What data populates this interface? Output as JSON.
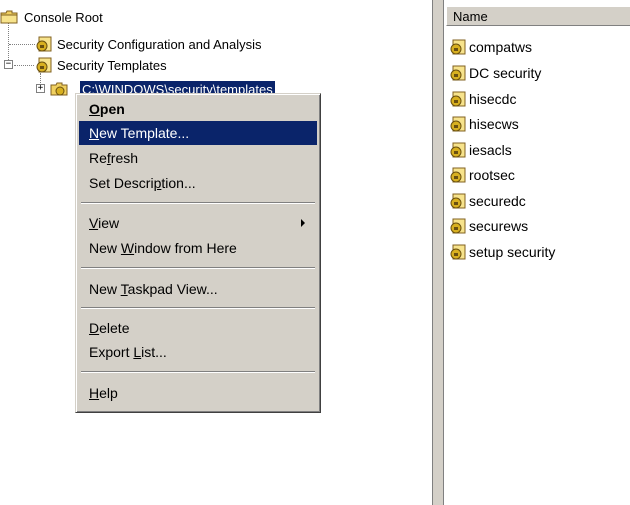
{
  "tree": {
    "root_label": "Console Root",
    "nodes": [
      {
        "label": "Security Configuration and Analysis"
      },
      {
        "label": "Security Templates"
      }
    ],
    "selected_path": "C:\\WINDOWS\\security\\templates"
  },
  "context_menu": {
    "items": [
      {
        "pre": "",
        "key": "O",
        "post": "pen"
      },
      {
        "pre": "",
        "key": "N",
        "post": "ew Template..."
      },
      {
        "pre": "Re",
        "key": "f",
        "post": "resh"
      },
      {
        "pre": "Set Descri",
        "key": "p",
        "post": "tion..."
      },
      {
        "pre": "",
        "key": "V",
        "post": "iew"
      },
      {
        "pre": "New ",
        "key": "W",
        "post": "indow from Here"
      },
      {
        "pre": "New ",
        "key": "T",
        "post": "askpad View..."
      },
      {
        "pre": "",
        "key": "D",
        "post": "elete"
      },
      {
        "pre": "Export ",
        "key": "L",
        "post": "ist..."
      },
      {
        "pre": "",
        "key": "H",
        "post": "elp"
      }
    ],
    "highlighted_index": 1
  },
  "list": {
    "column_header": "Name",
    "items": [
      "compatws",
      "DC security",
      "hisecdc",
      "hisecws",
      "iesacls",
      "rootsec",
      "securedc",
      "securews",
      "setup security"
    ]
  },
  "colors": {
    "selection": "#0a246a",
    "menu_face": "#d4d0c8",
    "folder": "#f0d060"
  },
  "icons": {
    "folder": "folder-icon",
    "template": "security-template-icon",
    "submenu": "submenu-arrow-icon"
  }
}
